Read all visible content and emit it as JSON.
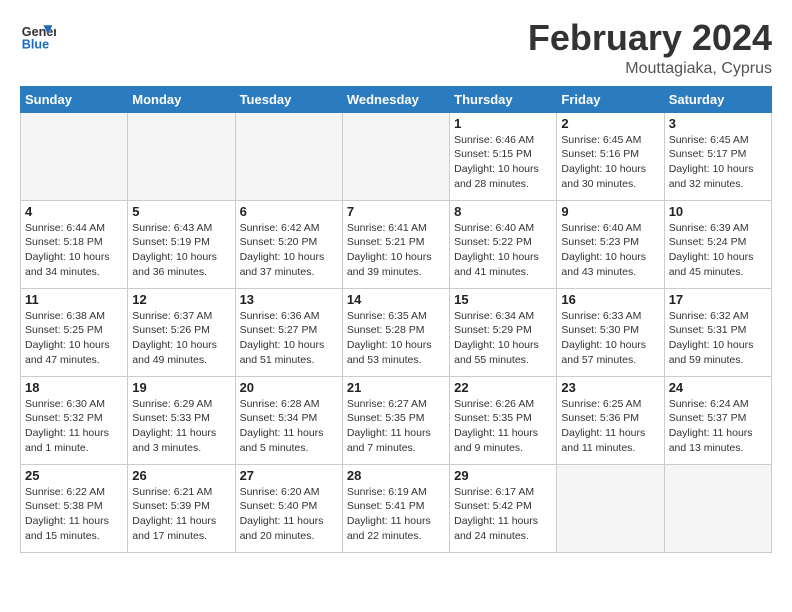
{
  "logo": {
    "line1": "General",
    "line2": "Blue"
  },
  "title": "February 2024",
  "location": "Mouttagiaka, Cyprus",
  "days_of_week": [
    "Sunday",
    "Monday",
    "Tuesday",
    "Wednesday",
    "Thursday",
    "Friday",
    "Saturday"
  ],
  "weeks": [
    [
      {
        "num": "",
        "info": ""
      },
      {
        "num": "",
        "info": ""
      },
      {
        "num": "",
        "info": ""
      },
      {
        "num": "",
        "info": ""
      },
      {
        "num": "1",
        "info": "Sunrise: 6:46 AM\nSunset: 5:15 PM\nDaylight: 10 hours\nand 28 minutes."
      },
      {
        "num": "2",
        "info": "Sunrise: 6:45 AM\nSunset: 5:16 PM\nDaylight: 10 hours\nand 30 minutes."
      },
      {
        "num": "3",
        "info": "Sunrise: 6:45 AM\nSunset: 5:17 PM\nDaylight: 10 hours\nand 32 minutes."
      }
    ],
    [
      {
        "num": "4",
        "info": "Sunrise: 6:44 AM\nSunset: 5:18 PM\nDaylight: 10 hours\nand 34 minutes."
      },
      {
        "num": "5",
        "info": "Sunrise: 6:43 AM\nSunset: 5:19 PM\nDaylight: 10 hours\nand 36 minutes."
      },
      {
        "num": "6",
        "info": "Sunrise: 6:42 AM\nSunset: 5:20 PM\nDaylight: 10 hours\nand 37 minutes."
      },
      {
        "num": "7",
        "info": "Sunrise: 6:41 AM\nSunset: 5:21 PM\nDaylight: 10 hours\nand 39 minutes."
      },
      {
        "num": "8",
        "info": "Sunrise: 6:40 AM\nSunset: 5:22 PM\nDaylight: 10 hours\nand 41 minutes."
      },
      {
        "num": "9",
        "info": "Sunrise: 6:40 AM\nSunset: 5:23 PM\nDaylight: 10 hours\nand 43 minutes."
      },
      {
        "num": "10",
        "info": "Sunrise: 6:39 AM\nSunset: 5:24 PM\nDaylight: 10 hours\nand 45 minutes."
      }
    ],
    [
      {
        "num": "11",
        "info": "Sunrise: 6:38 AM\nSunset: 5:25 PM\nDaylight: 10 hours\nand 47 minutes."
      },
      {
        "num": "12",
        "info": "Sunrise: 6:37 AM\nSunset: 5:26 PM\nDaylight: 10 hours\nand 49 minutes."
      },
      {
        "num": "13",
        "info": "Sunrise: 6:36 AM\nSunset: 5:27 PM\nDaylight: 10 hours\nand 51 minutes."
      },
      {
        "num": "14",
        "info": "Sunrise: 6:35 AM\nSunset: 5:28 PM\nDaylight: 10 hours\nand 53 minutes."
      },
      {
        "num": "15",
        "info": "Sunrise: 6:34 AM\nSunset: 5:29 PM\nDaylight: 10 hours\nand 55 minutes."
      },
      {
        "num": "16",
        "info": "Sunrise: 6:33 AM\nSunset: 5:30 PM\nDaylight: 10 hours\nand 57 minutes."
      },
      {
        "num": "17",
        "info": "Sunrise: 6:32 AM\nSunset: 5:31 PM\nDaylight: 10 hours\nand 59 minutes."
      }
    ],
    [
      {
        "num": "18",
        "info": "Sunrise: 6:30 AM\nSunset: 5:32 PM\nDaylight: 11 hours\nand 1 minute."
      },
      {
        "num": "19",
        "info": "Sunrise: 6:29 AM\nSunset: 5:33 PM\nDaylight: 11 hours\nand 3 minutes."
      },
      {
        "num": "20",
        "info": "Sunrise: 6:28 AM\nSunset: 5:34 PM\nDaylight: 11 hours\nand 5 minutes."
      },
      {
        "num": "21",
        "info": "Sunrise: 6:27 AM\nSunset: 5:35 PM\nDaylight: 11 hours\nand 7 minutes."
      },
      {
        "num": "22",
        "info": "Sunrise: 6:26 AM\nSunset: 5:35 PM\nDaylight: 11 hours\nand 9 minutes."
      },
      {
        "num": "23",
        "info": "Sunrise: 6:25 AM\nSunset: 5:36 PM\nDaylight: 11 hours\nand 11 minutes."
      },
      {
        "num": "24",
        "info": "Sunrise: 6:24 AM\nSunset: 5:37 PM\nDaylight: 11 hours\nand 13 minutes."
      }
    ],
    [
      {
        "num": "25",
        "info": "Sunrise: 6:22 AM\nSunset: 5:38 PM\nDaylight: 11 hours\nand 15 minutes."
      },
      {
        "num": "26",
        "info": "Sunrise: 6:21 AM\nSunset: 5:39 PM\nDaylight: 11 hours\nand 17 minutes."
      },
      {
        "num": "27",
        "info": "Sunrise: 6:20 AM\nSunset: 5:40 PM\nDaylight: 11 hours\nand 20 minutes."
      },
      {
        "num": "28",
        "info": "Sunrise: 6:19 AM\nSunset: 5:41 PM\nDaylight: 11 hours\nand 22 minutes."
      },
      {
        "num": "29",
        "info": "Sunrise: 6:17 AM\nSunset: 5:42 PM\nDaylight: 11 hours\nand 24 minutes."
      },
      {
        "num": "",
        "info": ""
      },
      {
        "num": "",
        "info": ""
      }
    ]
  ]
}
